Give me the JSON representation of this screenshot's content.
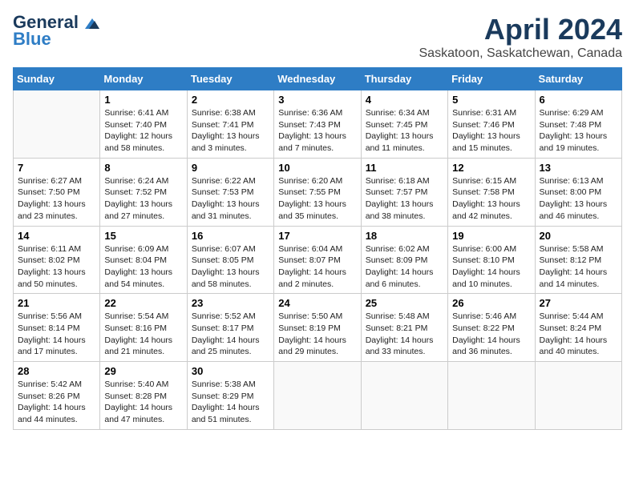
{
  "header": {
    "logo_line1": "General",
    "logo_line2": "Blue",
    "month": "April 2024",
    "location": "Saskatoon, Saskatchewan, Canada"
  },
  "days_of_week": [
    "Sunday",
    "Monday",
    "Tuesday",
    "Wednesday",
    "Thursday",
    "Friday",
    "Saturday"
  ],
  "weeks": [
    [
      {
        "day": "",
        "info": ""
      },
      {
        "day": "1",
        "info": "Sunrise: 6:41 AM\nSunset: 7:40 PM\nDaylight: 12 hours\nand 58 minutes."
      },
      {
        "day": "2",
        "info": "Sunrise: 6:38 AM\nSunset: 7:41 PM\nDaylight: 13 hours\nand 3 minutes."
      },
      {
        "day": "3",
        "info": "Sunrise: 6:36 AM\nSunset: 7:43 PM\nDaylight: 13 hours\nand 7 minutes."
      },
      {
        "day": "4",
        "info": "Sunrise: 6:34 AM\nSunset: 7:45 PM\nDaylight: 13 hours\nand 11 minutes."
      },
      {
        "day": "5",
        "info": "Sunrise: 6:31 AM\nSunset: 7:46 PM\nDaylight: 13 hours\nand 15 minutes."
      },
      {
        "day": "6",
        "info": "Sunrise: 6:29 AM\nSunset: 7:48 PM\nDaylight: 13 hours\nand 19 minutes."
      }
    ],
    [
      {
        "day": "7",
        "info": "Sunrise: 6:27 AM\nSunset: 7:50 PM\nDaylight: 13 hours\nand 23 minutes."
      },
      {
        "day": "8",
        "info": "Sunrise: 6:24 AM\nSunset: 7:52 PM\nDaylight: 13 hours\nand 27 minutes."
      },
      {
        "day": "9",
        "info": "Sunrise: 6:22 AM\nSunset: 7:53 PM\nDaylight: 13 hours\nand 31 minutes."
      },
      {
        "day": "10",
        "info": "Sunrise: 6:20 AM\nSunset: 7:55 PM\nDaylight: 13 hours\nand 35 minutes."
      },
      {
        "day": "11",
        "info": "Sunrise: 6:18 AM\nSunset: 7:57 PM\nDaylight: 13 hours\nand 38 minutes."
      },
      {
        "day": "12",
        "info": "Sunrise: 6:15 AM\nSunset: 7:58 PM\nDaylight: 13 hours\nand 42 minutes."
      },
      {
        "day": "13",
        "info": "Sunrise: 6:13 AM\nSunset: 8:00 PM\nDaylight: 13 hours\nand 46 minutes."
      }
    ],
    [
      {
        "day": "14",
        "info": "Sunrise: 6:11 AM\nSunset: 8:02 PM\nDaylight: 13 hours\nand 50 minutes."
      },
      {
        "day": "15",
        "info": "Sunrise: 6:09 AM\nSunset: 8:04 PM\nDaylight: 13 hours\nand 54 minutes."
      },
      {
        "day": "16",
        "info": "Sunrise: 6:07 AM\nSunset: 8:05 PM\nDaylight: 13 hours\nand 58 minutes."
      },
      {
        "day": "17",
        "info": "Sunrise: 6:04 AM\nSunset: 8:07 PM\nDaylight: 14 hours\nand 2 minutes."
      },
      {
        "day": "18",
        "info": "Sunrise: 6:02 AM\nSunset: 8:09 PM\nDaylight: 14 hours\nand 6 minutes."
      },
      {
        "day": "19",
        "info": "Sunrise: 6:00 AM\nSunset: 8:10 PM\nDaylight: 14 hours\nand 10 minutes."
      },
      {
        "day": "20",
        "info": "Sunrise: 5:58 AM\nSunset: 8:12 PM\nDaylight: 14 hours\nand 14 minutes."
      }
    ],
    [
      {
        "day": "21",
        "info": "Sunrise: 5:56 AM\nSunset: 8:14 PM\nDaylight: 14 hours\nand 17 minutes."
      },
      {
        "day": "22",
        "info": "Sunrise: 5:54 AM\nSunset: 8:16 PM\nDaylight: 14 hours\nand 21 minutes."
      },
      {
        "day": "23",
        "info": "Sunrise: 5:52 AM\nSunset: 8:17 PM\nDaylight: 14 hours\nand 25 minutes."
      },
      {
        "day": "24",
        "info": "Sunrise: 5:50 AM\nSunset: 8:19 PM\nDaylight: 14 hours\nand 29 minutes."
      },
      {
        "day": "25",
        "info": "Sunrise: 5:48 AM\nSunset: 8:21 PM\nDaylight: 14 hours\nand 33 minutes."
      },
      {
        "day": "26",
        "info": "Sunrise: 5:46 AM\nSunset: 8:22 PM\nDaylight: 14 hours\nand 36 minutes."
      },
      {
        "day": "27",
        "info": "Sunrise: 5:44 AM\nSunset: 8:24 PM\nDaylight: 14 hours\nand 40 minutes."
      }
    ],
    [
      {
        "day": "28",
        "info": "Sunrise: 5:42 AM\nSunset: 8:26 PM\nDaylight: 14 hours\nand 44 minutes."
      },
      {
        "day": "29",
        "info": "Sunrise: 5:40 AM\nSunset: 8:28 PM\nDaylight: 14 hours\nand 47 minutes."
      },
      {
        "day": "30",
        "info": "Sunrise: 5:38 AM\nSunset: 8:29 PM\nDaylight: 14 hours\nand 51 minutes."
      },
      {
        "day": "",
        "info": ""
      },
      {
        "day": "",
        "info": ""
      },
      {
        "day": "",
        "info": ""
      },
      {
        "day": "",
        "info": ""
      }
    ]
  ]
}
